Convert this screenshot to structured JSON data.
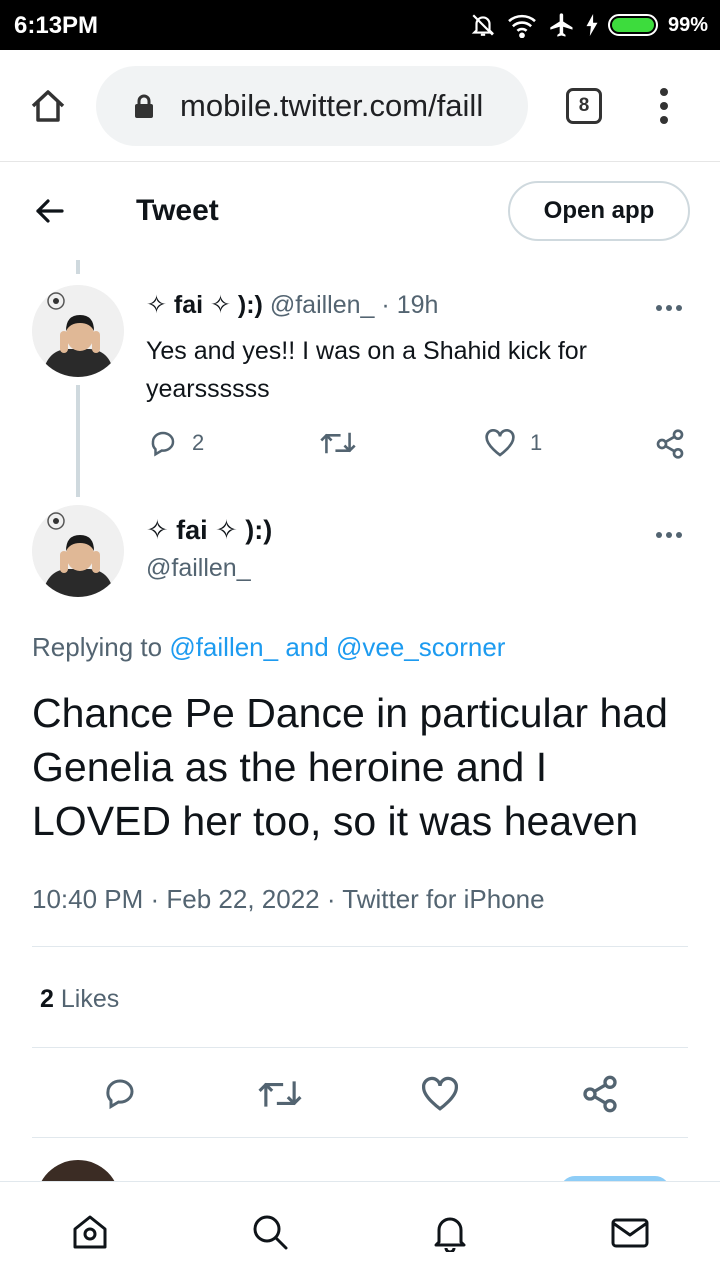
{
  "status_bar": {
    "time": "6:13PM",
    "battery_percent": "99%",
    "icons": [
      "mute-icon",
      "wifi-icon",
      "airplane-icon",
      "charging-icon",
      "battery-icon"
    ]
  },
  "browser": {
    "url": "mobile.twitter.com/faill",
    "tab_count": "8",
    "icons": [
      "home-icon",
      "lock-icon",
      "menu-icon"
    ]
  },
  "header": {
    "title": "Tweet",
    "open_app_label": "Open app"
  },
  "parent_tweet": {
    "display_name": "✧ fai ✧ ):)",
    "handle": "@faillen_",
    "separator": "·",
    "time": "19h",
    "text": "Yes and yes!! I was on a Shahid kick for yearssssss",
    "reply_count": "2",
    "retweet_count": "",
    "like_count": "1"
  },
  "main_tweet": {
    "display_name": "✧ fai ✧ ):)",
    "handle": "@faillen_",
    "replying_prefix": "Replying to",
    "replying_user1": "@faillen_",
    "replying_and": "and",
    "replying_user2": "@vee_scorner",
    "text": "Chance Pe Dance in particular had Genelia as the heroine and I LOVED her too, so it was heaven",
    "timestamp": "10:40 PM · Feb 22, 2022 · Twitter for iPhone",
    "likes_count": "2",
    "likes_label": "Likes"
  },
  "colors": {
    "link": "#1d9bf0",
    "secondary_text": "#536471",
    "primary_text": "#0f1419",
    "border": "#cfd9de"
  },
  "bottom_nav": [
    "home-icon",
    "search-icon",
    "notifications-icon",
    "messages-icon"
  ]
}
